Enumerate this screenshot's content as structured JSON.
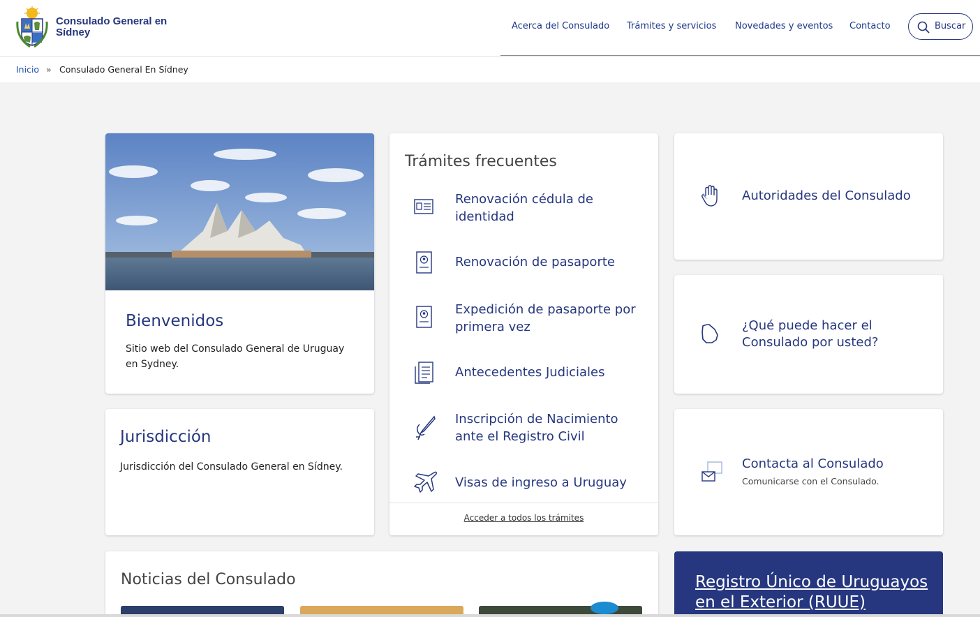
{
  "header": {
    "site_title": "Consulado General en Sídney",
    "nav": [
      {
        "label": "Acerca del Consulado"
      },
      {
        "label": "Trámites y servicios"
      },
      {
        "label": "Novedades y eventos"
      },
      {
        "label": "Contacto"
      }
    ],
    "search_label": "Buscar"
  },
  "breadcrumb": {
    "home": "Inicio",
    "separator": "»",
    "current": "Consulado General En Sídney"
  },
  "welcome": {
    "title": "Bienvenidos",
    "text": "Sitio web del Consulado General de Uruguay en Sydney."
  },
  "jurisdiction": {
    "title": "Jurisdicción",
    "text": "Jurisdicción del Consulado General en Sídney."
  },
  "tramites": {
    "title": "Trámites frecuentes",
    "items": [
      {
        "label": "Renovación cédula de identidad",
        "icon": "id-card-icon"
      },
      {
        "label": "Renovación de pasaporte",
        "icon": "passport-icon"
      },
      {
        "label": "Expedición de pasaporte por primera vez",
        "icon": "passport-icon"
      },
      {
        "label": "Antecedentes Judiciales",
        "icon": "document-list-icon"
      },
      {
        "label": "Inscripción de Nacimiento ante el Registro Civil",
        "icon": "pen-signature-icon"
      },
      {
        "label": "Visas de ingreso a Uruguay",
        "icon": "airplane-icon"
      }
    ],
    "all_link": "Acceder a todos los trámites"
  },
  "side_cards": {
    "authorities": {
      "label": "Autoridades del Consulado",
      "icon": "raised-hand-icon"
    },
    "what_can_do": {
      "label": "¿Qué puede hacer el Consulado por usted?",
      "icon": "uruguay-map-icon"
    },
    "contact": {
      "label": "Contacta al Consulado",
      "sub": "Comunicarse con el Consulado.",
      "icon": "envelope-screen-icon"
    }
  },
  "news": {
    "title": "Noticias del Consulado"
  },
  "ruue": {
    "label": "Registro Único de Uruguayos en el Exterior (RUUE)"
  },
  "colors": {
    "primary": "#26377f",
    "link": "#1f4ea8",
    "background": "#f3f3f3"
  }
}
